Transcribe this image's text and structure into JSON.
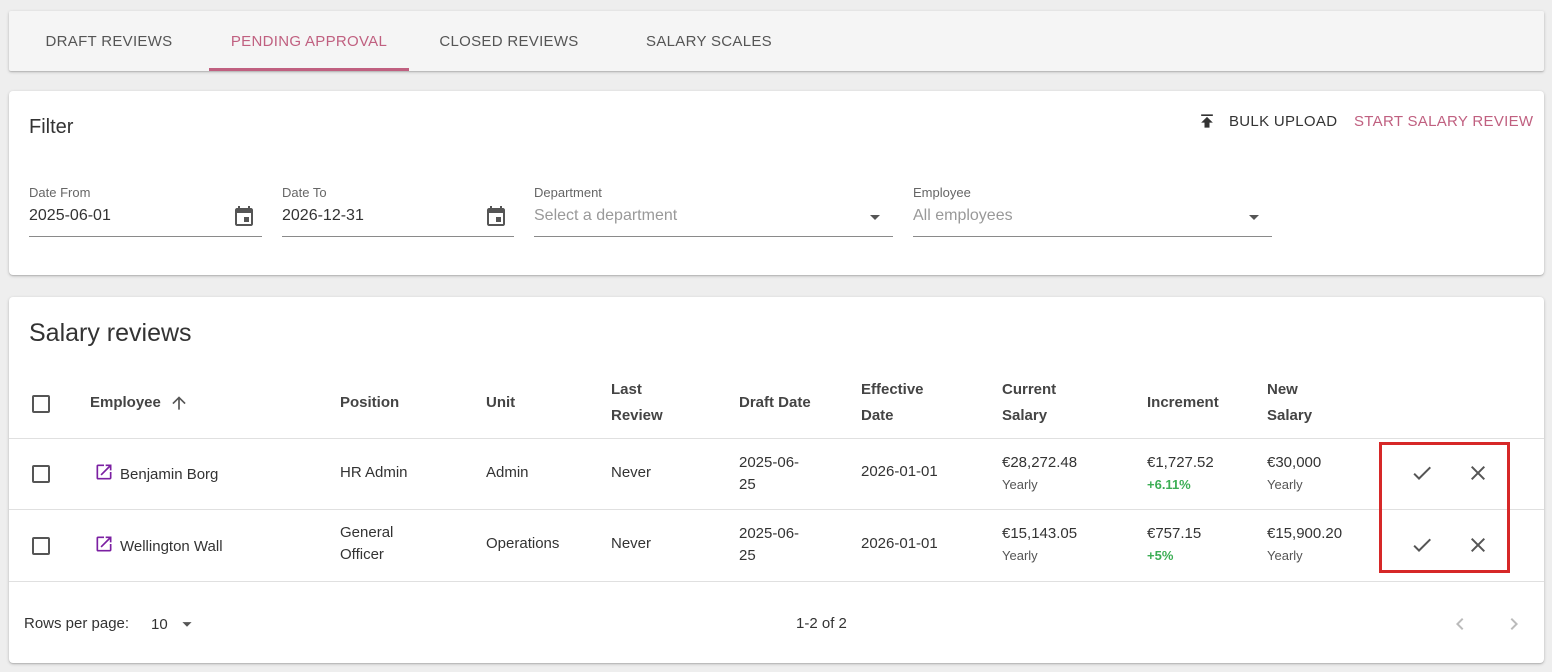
{
  "tabs": [
    {
      "label": "DRAFT REVIEWS"
    },
    {
      "label": "PENDING APPROVAL"
    },
    {
      "label": "CLOSED REVIEWS"
    },
    {
      "label": "SALARY SCALES"
    }
  ],
  "filter": {
    "title": "Filter",
    "bulk_upload": "BULK UPLOAD",
    "start_review": "START SALARY REVIEW",
    "date_from": {
      "label": "Date From",
      "value": "2025-06-01"
    },
    "date_to": {
      "label": "Date To",
      "value": "2026-12-31"
    },
    "department": {
      "label": "Department",
      "placeholder": "Select a department"
    },
    "employee": {
      "label": "Employee",
      "placeholder": "All employees"
    }
  },
  "reviews": {
    "title": "Salary reviews",
    "headers": {
      "employee": "Employee",
      "position": "Position",
      "unit": "Unit",
      "last_review_1": "Last",
      "last_review_2": "Review",
      "draft_date": "Draft Date",
      "effective_1": "Effective",
      "effective_2": "Date",
      "current_1": "Current",
      "current_2": "Salary",
      "increment": "Increment",
      "new_1": "New",
      "new_2": "Salary"
    },
    "rows": [
      {
        "employee": "Benjamin Borg",
        "position_1": "HR Admin",
        "position_2": "",
        "unit": "Admin",
        "last_review": "Never",
        "draft_1": "2025-06-",
        "draft_2": "25",
        "effective": "2026-01-01",
        "current": "€28,272.48",
        "current_period": "Yearly",
        "increment": "€1,727.52",
        "increment_pct": "+6.11%",
        "new": "€30,000",
        "new_period": "Yearly"
      },
      {
        "employee": "Wellington Wall",
        "position_1": "General",
        "position_2": "Officer",
        "unit": "Operations",
        "last_review": "Never",
        "draft_1": "2025-06-",
        "draft_2": "25",
        "effective": "2026-01-01",
        "current": "€15,143.05",
        "current_period": "Yearly",
        "increment": "€757.15",
        "increment_pct": "+5%",
        "new": "€15,900.20",
        "new_period": "Yearly"
      }
    ],
    "footer": {
      "rows_per_page_label": "Rows per page:",
      "rows_per_page": "10",
      "range": "1-2 of 2"
    }
  },
  "colors": {
    "accent": "#c06080",
    "increment_green": "#3cae55",
    "highlight_red": "#d62828"
  }
}
